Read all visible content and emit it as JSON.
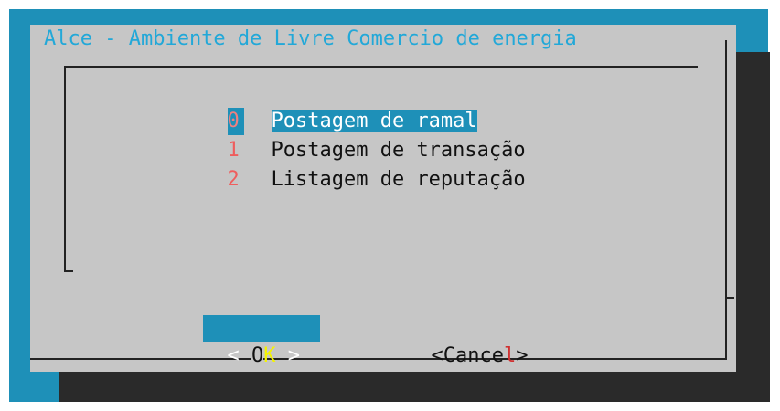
{
  "dialog": {
    "title": "Alce - Ambiente de Livre Comercio de energia"
  },
  "menu": {
    "items": [
      {
        "tag": "0",
        "label": "Postagem de ramal",
        "selected": true
      },
      {
        "tag": "1",
        "label": "Postagem de transação",
        "selected": false
      },
      {
        "tag": "2",
        "label": "Listagem de reputação",
        "selected": false
      }
    ]
  },
  "buttons": {
    "ok": {
      "left": "< ",
      "first": "O",
      "hot": "K",
      "right": " >"
    },
    "cancel": {
      "open": "<",
      "text_a": "Cance",
      "hot": "l",
      "close": ">"
    }
  },
  "colors": {
    "terminal_bg": "#1e90b8",
    "dialog_bg": "#c6c6c6",
    "shadow": "#2a2a2a",
    "title": "#22a8d8",
    "tag": "#ef5d5d",
    "hotkey": "#f4f400"
  }
}
